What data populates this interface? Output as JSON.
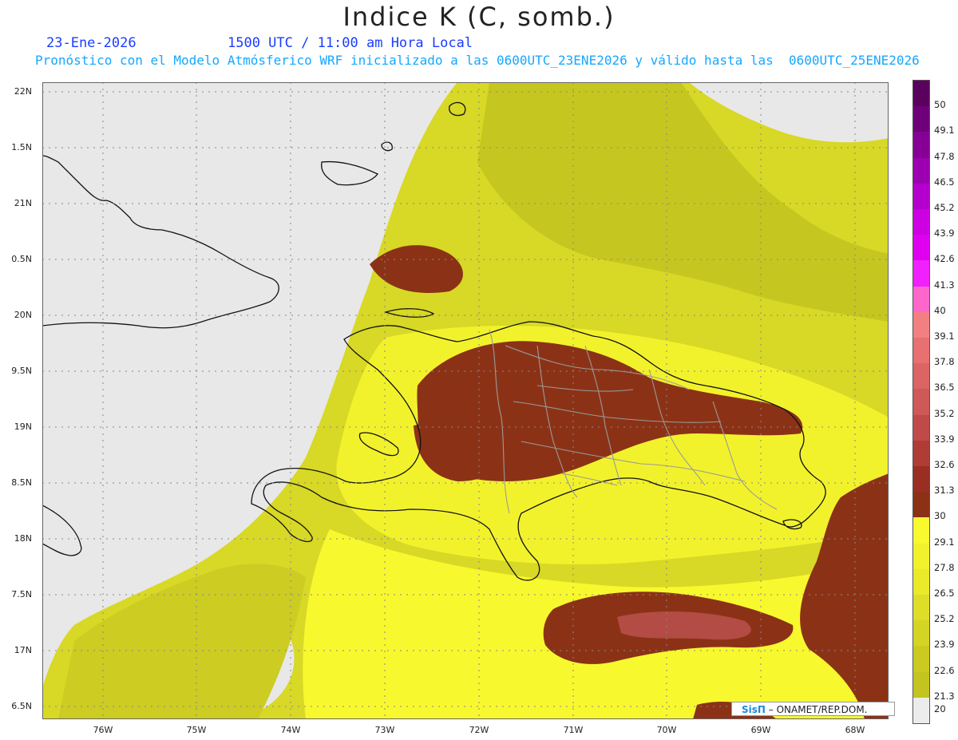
{
  "header": {
    "title": "Indice K (C, somb.)",
    "date": "23-Ene-2026",
    "time": "1500 UTC / 11:00 am Hora Local",
    "description": "Pronóstico con el Modelo Atmósferico WRF inicializado a las 0600UTC_23ENE2026 y válido hasta las  0600UTC_25ENE2026"
  },
  "axes": {
    "latitude_labels": [
      "22N",
      "1.5N",
      "21N",
      "0.5N",
      "20N",
      "9.5N",
      "19N",
      "8.5N",
      "18N",
      "7.5N",
      "17N",
      "6.5N"
    ],
    "longitude_labels": [
      "76W",
      "75W",
      "74W",
      "73W",
      "72W",
      "71W",
      "70W",
      "69W",
      "68W"
    ]
  },
  "colorbar": {
    "labels": [
      "50",
      "49.1",
      "47.8",
      "46.5",
      "45.2",
      "43.9",
      "42.6",
      "41.3",
      "40",
      "39.1",
      "37.8",
      "36.5",
      "35.2",
      "33.9",
      "32.6",
      "31.3",
      "30",
      "29.1",
      "27.8",
      "26.5",
      "25.2",
      "23.9",
      "22.6",
      "21.3",
      "20"
    ],
    "colors": [
      "#5a005e",
      "#6e007a",
      "#860096",
      "#9c00b0",
      "#b400cc",
      "#cc00e0",
      "#e000f0",
      "#f020ff",
      "#ff66cc",
      "#f28080",
      "#e87070",
      "#dc6464",
      "#cf5858",
      "#c04a4a",
      "#b03c36",
      "#9a2e22",
      "#8b3216",
      "#f9f930",
      "#f2f22c",
      "#eaea2a",
      "#dede28",
      "#d4d424",
      "#caca20",
      "#c4c420",
      "#ececec"
    ]
  },
  "map": {
    "no_data_color": "#e8e8e8",
    "field_colors": {
      "low": "#c8c820",
      "mid": "#dede28",
      "high": "#f8f82e",
      "peak": "#8b3216",
      "peak_light": "#b04a40"
    },
    "coastline_color": "#111111",
    "border_color": "#9a9a9a"
  },
  "credit": {
    "brand": "SisΠ",
    "text": "– ONAMET/REP.DOM."
  }
}
